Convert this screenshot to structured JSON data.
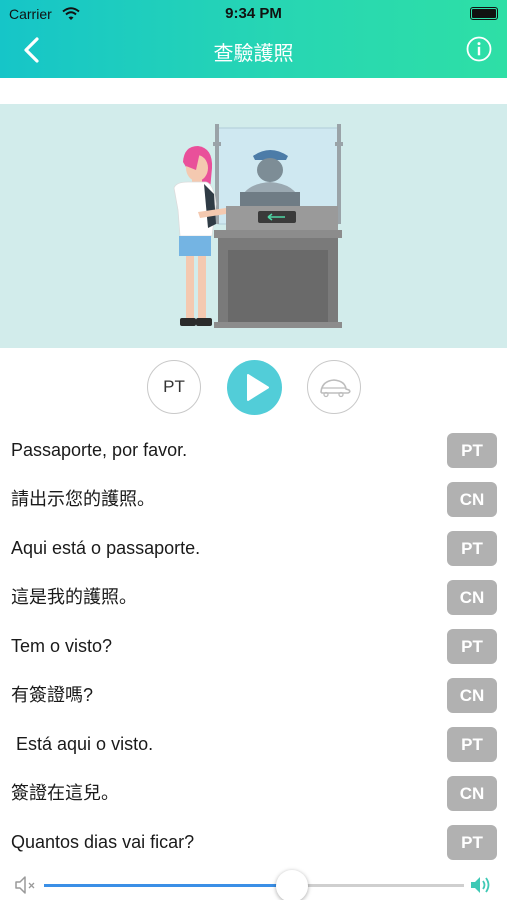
{
  "status_bar": {
    "carrier": "Carrier",
    "time": "9:34 PM"
  },
  "nav": {
    "title": "查驗護照",
    "back_icon": "chevron-left-icon",
    "info_icon": "info-circle-icon"
  },
  "controls": {
    "language_toggle": "PT",
    "play_icon": "play-icon",
    "speed_icon": "turtle-icon"
  },
  "phrases": [
    {
      "text": "Passaporte, por favor.",
      "lang": "PT"
    },
    {
      "text": "請出示您的護照。",
      "lang": "CN"
    },
    {
      "text": "Aqui está o passaporte.",
      "lang": "PT"
    },
    {
      "text": "這是我的護照。",
      "lang": "CN"
    },
    {
      "text": "Tem o visto?",
      "lang": "PT"
    },
    {
      "text": "有簽證嗎?",
      "lang": "CN"
    },
    {
      "text": " Está aqui o visto.",
      "lang": "PT"
    },
    {
      "text": "簽證在這兒。",
      "lang": "CN"
    },
    {
      "text": "Quantos dias vai ficar?",
      "lang": "PT"
    }
  ],
  "volume": {
    "level": 0.59,
    "mute_icon": "speaker-mute-icon",
    "loud_icon": "speaker-loud-icon"
  },
  "colors": {
    "header_start": "#16c5c8",
    "header_end": "#2edfa6",
    "play_button": "#52cdd8",
    "badge": "#b1b1b1",
    "volume_fill": "#3b8fe6",
    "scene_background": "#d2eceb"
  }
}
